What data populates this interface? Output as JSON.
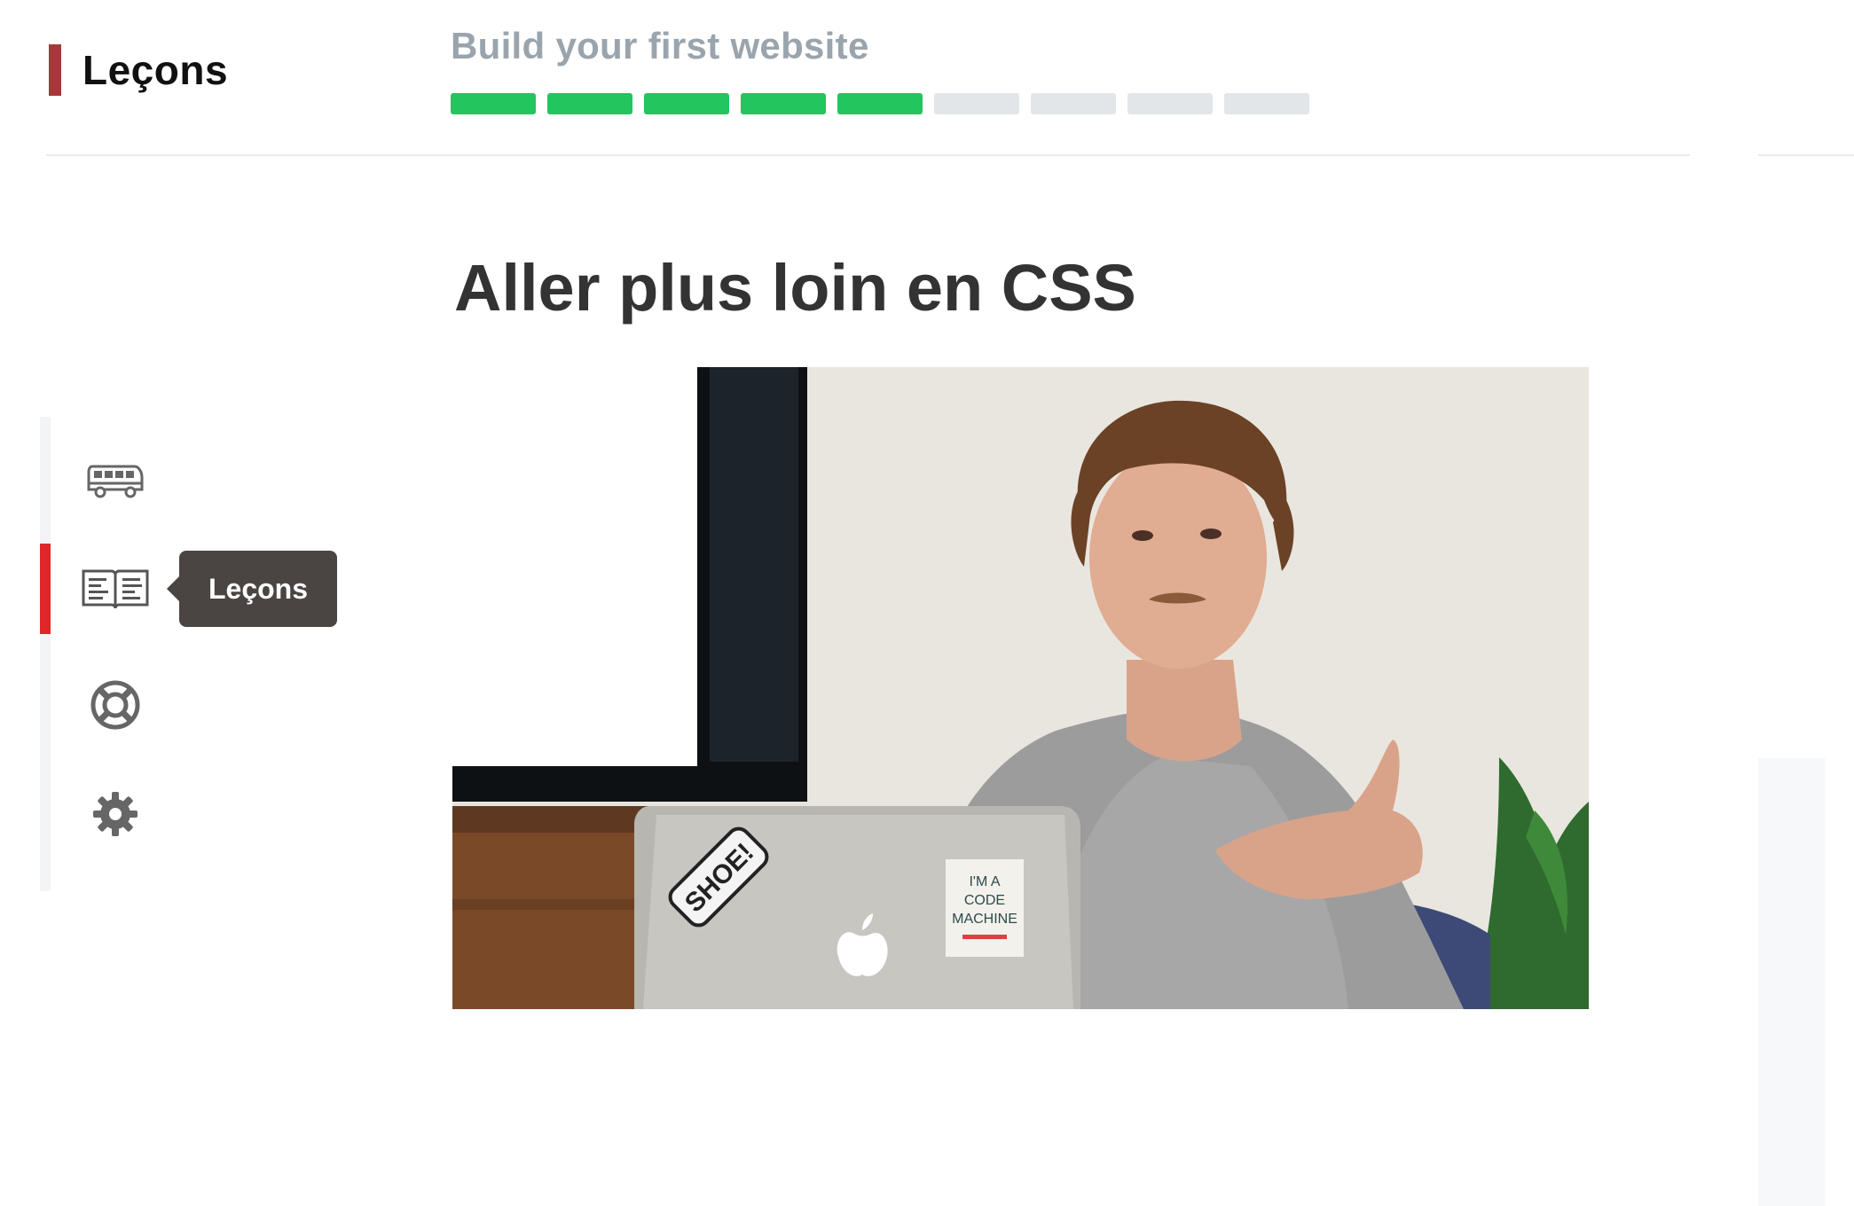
{
  "header": {
    "brand_title": "Leçons",
    "course_title": "Build your first website",
    "progress": {
      "completed": 5,
      "total": 9
    }
  },
  "lesson": {
    "title": "Aller plus loin en CSS"
  },
  "video": {
    "sticker_left": "SHOE!",
    "sticker_right_line1": "I'M A",
    "sticker_right_line2": "CODE",
    "sticker_right_line3": "MACHINE"
  },
  "sidebar": {
    "items": [
      {
        "icon": "bus-icon",
        "active": false
      },
      {
        "icon": "book-icon",
        "active": true
      },
      {
        "icon": "lifebuoy-icon",
        "active": false
      },
      {
        "icon": "gear-icon",
        "active": false
      }
    ],
    "tooltip": "Leçons"
  },
  "colors": {
    "accent": "#e0262a",
    "brand_bar": "#a33a3a",
    "progress_done": "#22c55e",
    "progress_todo": "#e3e6e8",
    "course_title": "#9aa4ad",
    "tooltip_bg": "#4a4443"
  }
}
